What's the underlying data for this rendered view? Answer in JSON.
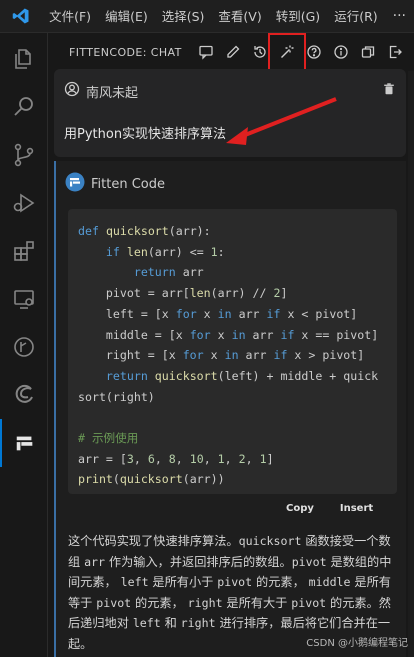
{
  "titlebar": {
    "menu": [
      "文件(F)",
      "编辑(E)",
      "选择(S)",
      "查看(V)",
      "转到(G)",
      "运行(R)"
    ],
    "more": "···"
  },
  "panel": {
    "title": "FITTENCODE: CHAT",
    "actions": [
      "comment-icon",
      "pencil-icon",
      "history-icon",
      "magic-wand-icon",
      "help-icon",
      "info-icon",
      "copy-window-icon",
      "exit-icon"
    ],
    "highlight_action": "magic-wand-icon"
  },
  "user": {
    "name": "南风未起",
    "message": "用Python实现快速排序算法"
  },
  "assistant": {
    "name": "Fitten Code",
    "code": [
      "def quicksort(arr):",
      "    if len(arr) <= 1:",
      "        return arr",
      "    pivot = arr[len(arr) // 2]",
      "    left = [x for x in arr if x < pivot]",
      "    middle = [x for x in arr if x == pivot]",
      "    right = [x for x in arr if x > pivot]",
      "    return quicksort(left) + middle + quick",
      "sort(right)",
      "",
      "# 示例使用",
      "arr = [3, 6, 8, 10, 1, 2, 1]",
      "print(quicksort(arr))"
    ],
    "buttons": {
      "copy": "Copy",
      "insert": "Insert"
    },
    "explanation": [
      [
        "这个代码实现了快速排序算法。",
        "quicksort",
        " 函数接受一个数组 ",
        "arr",
        " 作为输入，并返回排序后的数组。",
        "pivot",
        " 是数组的中间元素， ",
        "left",
        " 是所有小于 ",
        "pivot",
        " 的元素， ",
        "middle",
        " 是所有等于 ",
        "pivot",
        " 的元素， ",
        "right",
        " 是所有大于 ",
        "pivot",
        " 的元素。然后递归地对 ",
        "left",
        " 和 ",
        "right",
        " 进行排序，最后将它们合并在一起。"
      ]
    ]
  },
  "watermark": "CSDN @小鹅编程笔记",
  "colors": {
    "accent": "#0078d4",
    "highlight": "#e02020",
    "keyword": "#569cd6",
    "function": "#dcdcaa",
    "comment": "#6a9955"
  }
}
